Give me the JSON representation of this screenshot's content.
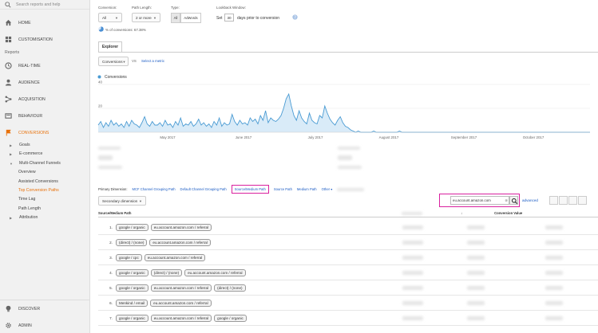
{
  "sidebar": {
    "search_placeholder": "Search reports and help",
    "home": "HOME",
    "customisation": "CUSTOMISATION",
    "reports_section": "Reports",
    "realtime": "REAL-TIME",
    "audience": "AUDIENCE",
    "acquisition": "ACQUISITION",
    "behaviour": "BEHAVIOUR",
    "conversions": "CONVERSIONS",
    "goals": "Goals",
    "ecommerce": "E-commerce",
    "mcf": "Multi-Channel Funnels",
    "overview": "Overview",
    "assisted": "Assisted Conversions",
    "top_paths": "Top Conversion Paths",
    "time_lag": "Time Lag",
    "path_length": "Path Length",
    "attribution": "Attribution",
    "discover": "DISCOVER",
    "admin": "ADMIN"
  },
  "controls": {
    "conversion_label": "Conversion:",
    "conversion_value": "All",
    "path_length_label": "Path Length:",
    "path_length_value": "2 or more",
    "type_label": "Type:",
    "type_all": "All",
    "type_adwords": "AdWords",
    "lookback_label": "Lookback Window:",
    "set_label": "Set",
    "lookback_value": "30",
    "lookback_suffix": "days prior to conversion",
    "pct_text": "% of conversions: 67.38%"
  },
  "explorer": {
    "tab": "Explorer",
    "metric_select": "Conversions",
    "vs": "VS",
    "select_metric": "Select a metric",
    "legend": "Conversions"
  },
  "chart_data": {
    "type": "area",
    "series": [
      {
        "name": "Conversions"
      }
    ],
    "y_ticks": [
      "40",
      "20"
    ],
    "x_labels": [
      "May 2017",
      "June 2017",
      "July 2017",
      "August 2017",
      "September 2017",
      "October 2017"
    ],
    "ylim": [
      0,
      40
    ],
    "values": [
      6,
      9,
      4,
      8,
      5,
      10,
      6,
      8,
      5,
      7,
      4,
      9,
      5,
      10,
      7,
      6,
      4,
      8,
      13,
      7,
      5,
      9,
      6,
      6,
      8,
      5,
      10,
      6,
      7,
      4,
      9,
      6,
      12,
      5,
      7,
      6,
      9,
      5,
      7,
      11,
      6,
      8,
      5,
      7,
      4,
      9,
      6,
      12,
      5,
      8,
      6,
      7,
      15,
      9,
      6,
      10,
      7,
      8,
      6,
      12,
      9,
      11,
      7,
      14,
      10,
      18,
      8,
      12,
      10,
      9,
      11,
      14,
      20,
      28,
      32,
      22,
      14,
      10,
      18,
      12,
      9,
      7,
      16,
      10,
      8,
      7,
      14,
      12,
      22,
      16,
      11,
      8,
      6,
      10,
      13,
      8,
      5,
      4,
      2,
      1,
      0,
      1,
      0,
      0,
      0,
      0,
      0,
      1,
      0,
      0,
      0,
      0,
      0,
      0,
      0,
      0,
      0,
      1,
      0,
      0,
      0,
      0,
      0,
      0,
      0,
      0,
      0,
      0,
      0,
      0,
      0,
      0,
      0,
      0,
      0,
      0,
      0,
      0,
      0,
      0,
      0,
      0,
      0,
      0,
      0,
      0,
      0,
      0,
      0,
      0,
      0,
      0,
      0,
      0,
      0,
      0,
      0,
      0,
      0,
      0,
      0,
      0,
      0,
      0,
      0,
      0,
      0,
      0,
      0,
      0,
      0,
      0,
      0,
      0,
      0,
      0,
      0,
      0,
      0,
      0,
      0,
      0,
      0,
      0,
      0,
      0,
      0,
      0,
      0,
      0,
      0,
      0
    ],
    "grid": true,
    "color": "#4a9bd3"
  },
  "dimensions": {
    "primary_label": "Primary Dimension:",
    "items": [
      "MCF Channel Grouping Path",
      "Default Channel Grouping Path",
      "Source/Medium Path",
      "Source Path",
      "Medium Path",
      "Other"
    ],
    "secondary": "Secondary dimension"
  },
  "search": {
    "value": "eu.account.amazon.com",
    "clear": "⊗",
    "advanced": "advanced"
  },
  "table": {
    "col_path": "Source/Medium Path",
    "col_value": "Conversion Value",
    "rows": [
      {
        "num": "1.",
        "chips": [
          "google / organic",
          "eu.account.amazon.com / referral"
        ]
      },
      {
        "num": "2.",
        "chips": [
          "(direct) / (none)",
          "eu.account.amazon.com / referral"
        ]
      },
      {
        "num": "3.",
        "chips": [
          "google / cpc",
          "eu.account.amazon.com / referral"
        ]
      },
      {
        "num": "4.",
        "chips": [
          "google / organic",
          "(direct) / (none)",
          "eu.account.amazon.com / referral"
        ]
      },
      {
        "num": "5.",
        "chips": [
          "google / organic",
          "eu.account.amazon.com / referral",
          "(direct) / (none)"
        ]
      },
      {
        "num": "6.",
        "chips": [
          "Menkind / email",
          "eu.account.amazon.com / referral"
        ]
      },
      {
        "num": "7.",
        "chips": [
          "google / organic",
          "eu.account.amazon.com / referral",
          "google / organic"
        ]
      }
    ]
  }
}
